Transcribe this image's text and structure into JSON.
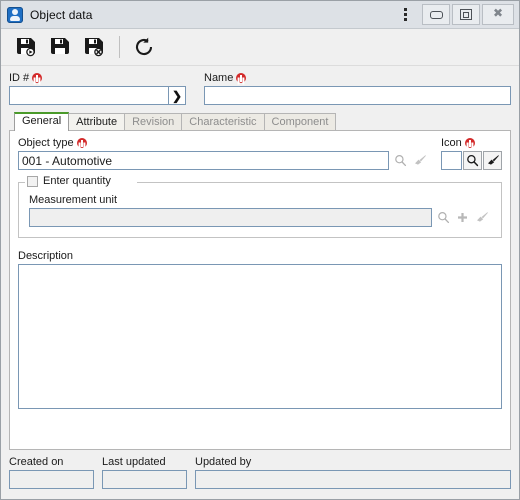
{
  "window": {
    "title": "Object data",
    "app_icon": "object-data-app-icon",
    "controls": {
      "menu": "kebab-menu-icon",
      "minimize": "minimize-icon",
      "maximize": "maximize-icon",
      "close": "close-icon"
    }
  },
  "toolbar": {
    "buttons": [
      {
        "name": "save-and-new-button",
        "icon": "save-new-icon",
        "title": "Save and new"
      },
      {
        "name": "save-button",
        "icon": "save-icon",
        "title": "Save"
      },
      {
        "name": "save-and-close-button",
        "icon": "save-close-icon",
        "title": "Save and close"
      },
      {
        "name": "refresh-button",
        "icon": "refresh-icon",
        "title": "Refresh"
      }
    ]
  },
  "header_fields": {
    "id": {
      "label": "ID #",
      "required": true,
      "value": "",
      "placeholder": "",
      "button_icon": "chevron-right-icon"
    },
    "name": {
      "label": "Name",
      "required": true,
      "value": "",
      "placeholder": ""
    }
  },
  "tabs": [
    {
      "label": "General",
      "state": "active"
    },
    {
      "label": "Attribute",
      "state": "enabled"
    },
    {
      "label": "Revision",
      "state": "disabled"
    },
    {
      "label": "Characteristic",
      "state": "disabled"
    },
    {
      "label": "Component",
      "state": "disabled"
    }
  ],
  "general_tab": {
    "object_type": {
      "label": "Object type",
      "required": true,
      "value": "001 - Automotive",
      "search_icon": "search-icon",
      "clear_icon": "brush-icon"
    },
    "icon_field": {
      "label": "Icon",
      "required": true,
      "value": "",
      "search_icon": "search-icon",
      "clear_icon": "brush-icon"
    },
    "quantity_group": {
      "title": "Enter quantity",
      "checked": false,
      "measurement_unit": {
        "label": "Measurement unit",
        "value": "",
        "search_icon": "search-icon",
        "add_icon": "plus-icon",
        "clear_icon": "brush-icon"
      }
    },
    "description": {
      "label": "Description",
      "value": ""
    }
  },
  "footer": {
    "created_on": {
      "label": "Created on",
      "value": ""
    },
    "last_updated": {
      "label": "Last updated",
      "value": ""
    },
    "updated_by": {
      "label": "Updated by",
      "value": ""
    }
  },
  "colors": {
    "accent_green": "#4a9a2a",
    "required_red": "#d32a2a",
    "titlebar": "#dde1e6",
    "form_background": "#f0f0f0",
    "panel_background": "#ffffff",
    "field_border": "#7a97b4"
  }
}
